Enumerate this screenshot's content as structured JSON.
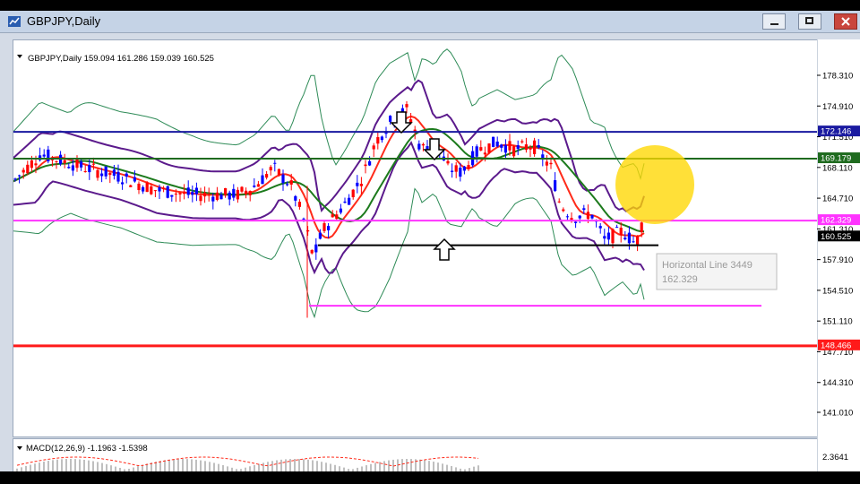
{
  "window": {
    "title": "GBPJPY,Daily",
    "colors": {
      "titlebar": "#c5d3e6",
      "close": "#c9463d"
    }
  },
  "chart_header": "GBPJPY,Daily  159.094 161.286 159.039 160.525",
  "price_axis": {
    "ticks": [
      "178.310",
      "174.910",
      "171.510",
      "168.110",
      "164.710",
      "161.310",
      "157.910",
      "154.510",
      "151.110",
      "147.710",
      "144.310",
      "141.010"
    ],
    "tags": [
      {
        "text": "172.146",
        "bg": "#1a1aa0",
        "fg": "#ffffff"
      },
      {
        "text": "169.179",
        "bg": "#1f6b1f",
        "fg": "#ffffff"
      },
      {
        "text": "162.329",
        "bg": "#ff33ff",
        "fg": "#ffffff"
      },
      {
        "text": "160.525",
        "bg": "#000000",
        "fg": "#ffffff"
      },
      {
        "text": "148.466",
        "bg": "#ff1a1a",
        "fg": "#ffffff"
      }
    ]
  },
  "horizontal_lines": [
    {
      "price": "172.146",
      "color": "#1a1aa0"
    },
    {
      "price": "169.179",
      "color": "#1f6b1f"
    },
    {
      "price": "162.329",
      "color": "#ff33ff"
    },
    {
      "price": "159.600",
      "color": "#000000"
    },
    {
      "price": "152.900",
      "color": "#ff33ff"
    },
    {
      "price": "148.466",
      "color": "#ff1a1a"
    }
  ],
  "tooltip": {
    "line1": "Horizontal Line 3449",
    "line2": "162.329"
  },
  "macd": {
    "label": "MACD(12,26,9) -1.1963 -1.5398",
    "axis_value": "2.3641"
  },
  "highlight": {
    "color": "#ffd700"
  }
}
